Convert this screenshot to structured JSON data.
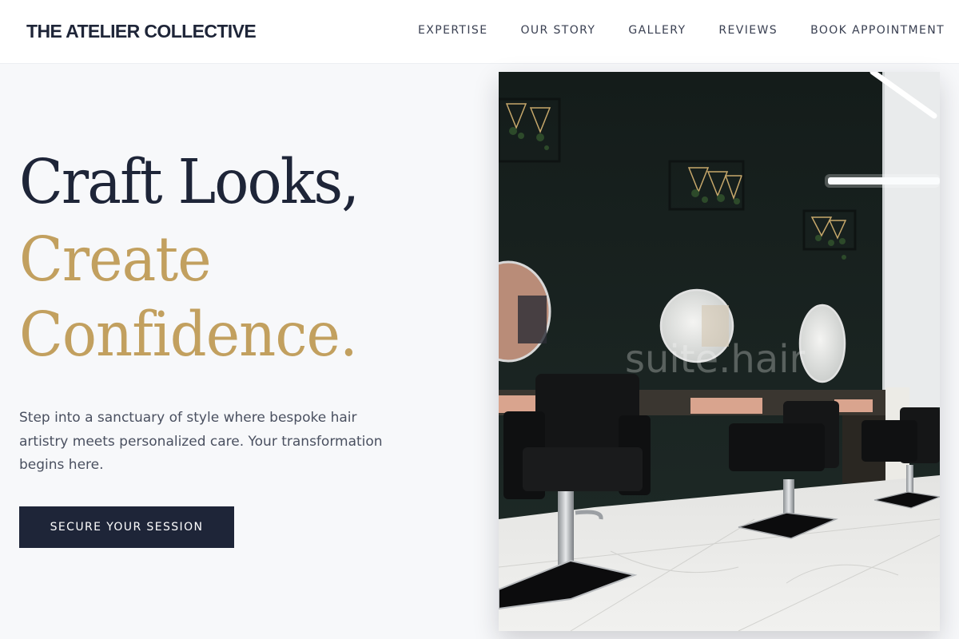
{
  "header": {
    "brand": "THE ATELIER COLLECTIVE",
    "nav": [
      {
        "label": "EXPERTISE"
      },
      {
        "label": "OUR STORY"
      },
      {
        "label": "GALLERY"
      },
      {
        "label": "REVIEWS"
      },
      {
        "label": "BOOK APPOINTMENT"
      }
    ]
  },
  "hero": {
    "headline_line1": "Craft Looks,",
    "headline_line2": "Create",
    "headline_line3": "Confidence.",
    "description": "Step into a sanctuary of style where bespoke hair artistry meets personalized care. Your transformation begins here.",
    "cta_label": "SECURE YOUR SESSION"
  },
  "image": {
    "watermark": "suite.hair"
  },
  "colors": {
    "navy": "#1e2538",
    "gold": "#c2a05f",
    "background": "#f7f8fa"
  }
}
